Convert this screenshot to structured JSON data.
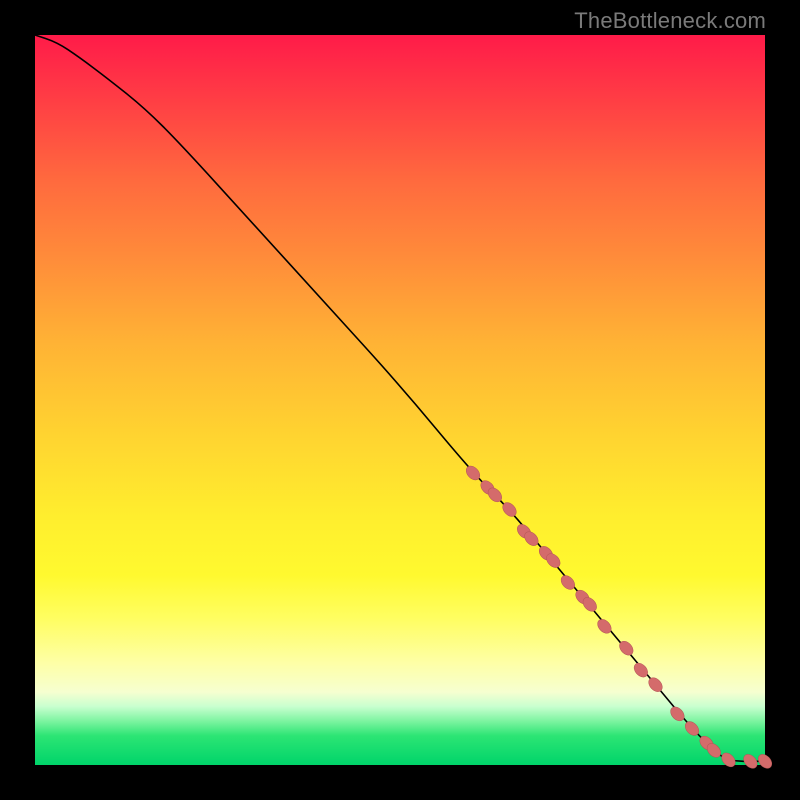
{
  "watermark": "TheBottleneck.com",
  "colors": {
    "dot": "#d46b6b",
    "curve": "#000000"
  },
  "chart_data": {
    "type": "line",
    "title": "",
    "xlabel": "",
    "ylabel": "",
    "xlim": [
      0,
      100
    ],
    "ylim": [
      0,
      100
    ],
    "grid": false,
    "legend": false,
    "series": [
      {
        "name": "curve",
        "kind": "line",
        "x": [
          0,
          3,
          6,
          10,
          15,
          20,
          30,
          40,
          50,
          60,
          65,
          70,
          75,
          80,
          85,
          90,
          94,
          96,
          98,
          100
        ],
        "y": [
          100,
          99,
          97,
          94,
          90,
          85,
          74,
          63,
          52,
          40,
          35,
          29,
          23,
          17,
          11,
          5,
          1,
          0.5,
          0.5,
          0.5
        ]
      },
      {
        "name": "markers",
        "kind": "scatter",
        "x": [
          60,
          62,
          63,
          65,
          67,
          68,
          70,
          71,
          73,
          75,
          76,
          78,
          81,
          83,
          85,
          88,
          90,
          92,
          93,
          95,
          98,
          100
        ],
        "y": [
          40,
          38,
          37,
          35,
          32,
          31,
          29,
          28,
          25,
          23,
          22,
          19,
          16,
          13,
          11,
          7,
          5,
          3,
          2,
          0.7,
          0.5,
          0.5
        ]
      }
    ]
  }
}
